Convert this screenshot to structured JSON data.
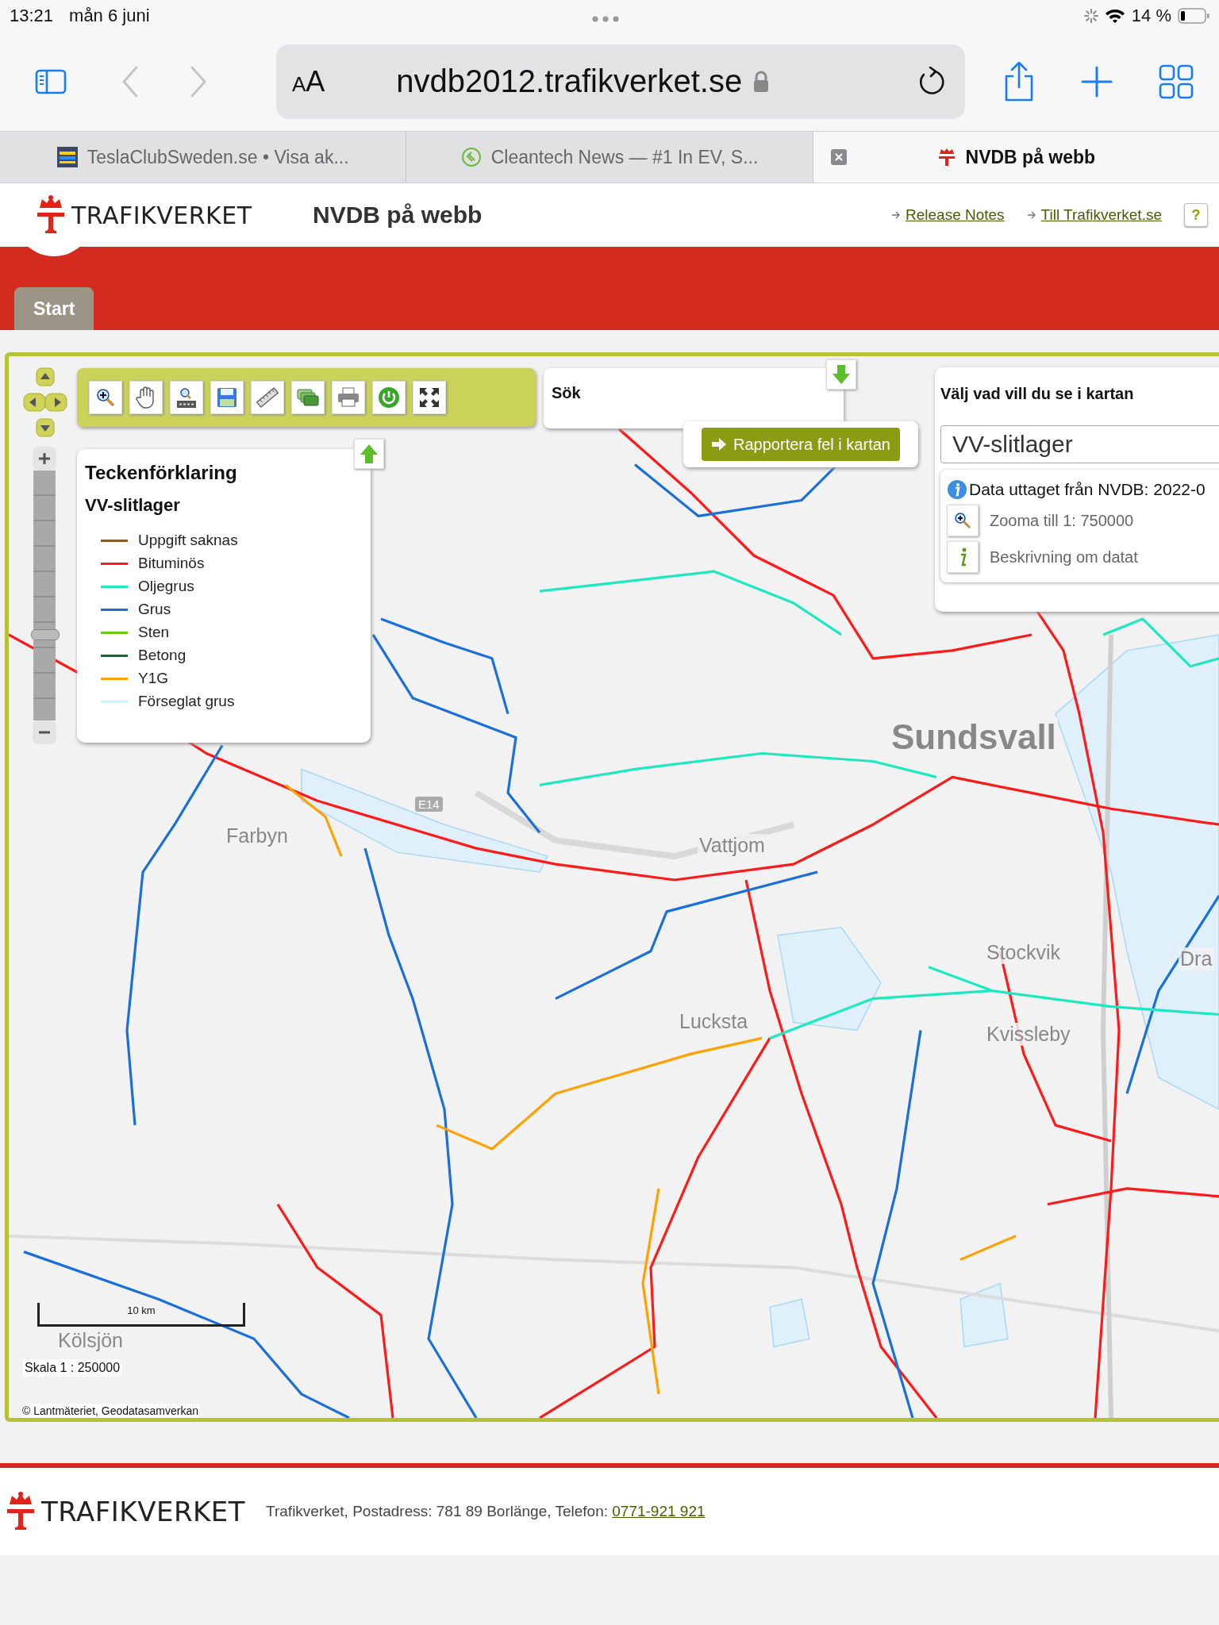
{
  "status_bar": {
    "time": "13:21",
    "date": "mån 6 juni",
    "battery": "14 %"
  },
  "browser": {
    "text_size": "AA",
    "url": "nvdb2012.trafikverket.se",
    "tabs": [
      {
        "title": "TeslaClubSweden.se • Visa ak...",
        "selected": false
      },
      {
        "title": "Cleantech News — #1 In EV, S...",
        "selected": false
      },
      {
        "title": "NVDB på webb",
        "selected": true
      }
    ]
  },
  "site_header": {
    "logo": "TRAFIKVERKET",
    "title": "NVDB på webb",
    "links": [
      "Release Notes",
      "Till Trafikverket.se"
    ],
    "help": "?"
  },
  "nav_tabs": [
    {
      "label": "Start",
      "selected": true
    }
  ],
  "map": {
    "zoom_slider": {
      "level": 0.32
    },
    "search": {
      "title": "Sök"
    },
    "report_button": "Rapportera fel i kartan",
    "legend": {
      "title": "Teckenförklaring",
      "subtitle": "VV-slitlager",
      "items": [
        {
          "label": "Uppgift saknas",
          "color": "#8b5a2b"
        },
        {
          "label": "Bituminös",
          "color": "#ff1a1a"
        },
        {
          "label": "Oljegrus",
          "color": "#1ee8c0"
        },
        {
          "label": "Grus",
          "color": "#1a6fd8"
        },
        {
          "label": "Sten",
          "color": "#66cc11"
        },
        {
          "label": "Betong",
          "color": "#0a6a3a"
        },
        {
          "label": "Y1G",
          "color": "#ffa200"
        },
        {
          "label": "Förseglat grus",
          "color": "#c8f6ff"
        }
      ]
    },
    "layer_panel": {
      "title": "Välj vad vill du se i kartan",
      "select_value": "VV-slitlager",
      "info": "Data uttaget från NVDB: 2022-0",
      "actions": [
        {
          "kind": "zoom",
          "label": "Zooma till 1: 750000"
        },
        {
          "kind": "info",
          "label": "Beskrivning om datat"
        }
      ]
    },
    "places": [
      "Sundsvall",
      "Vattjom",
      "Farbyn",
      "Stockvik",
      "Lucksta",
      "Kvissleby",
      "Dra",
      "Kölsjön"
    ],
    "road_badge": "E14",
    "scale_bar": "10 km",
    "scale": "Skala 1 : 250000",
    "copyright": "© Lantmäteriet, Geodatasamverkan"
  },
  "footer": {
    "logo": "TRAFIKVERKET",
    "address": "Trafikverket, Postadress: 781 89 Borlänge, Telefon: ",
    "phone": "0771-921 921"
  }
}
